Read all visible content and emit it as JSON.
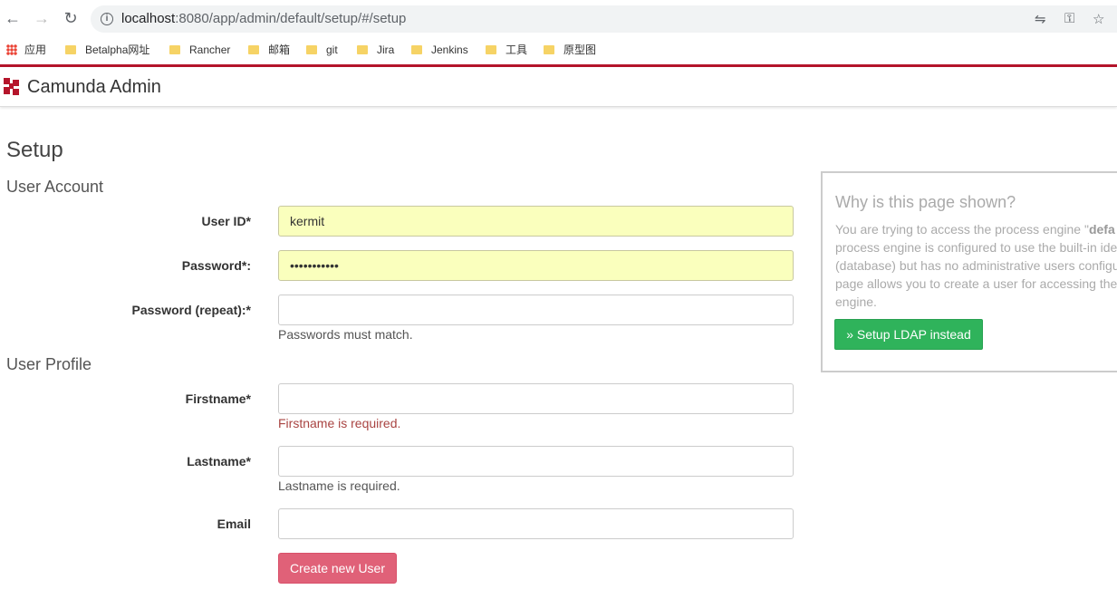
{
  "browser": {
    "url_host": "localhost",
    "url_rest": ":8080/app/admin/default/setup/#/setup",
    "bookmarks": [
      {
        "label": "应用",
        "icon": "apps-grid-icon"
      },
      {
        "label": "Betalpha网址",
        "icon": "folder-icon"
      },
      {
        "label": "Rancher",
        "icon": "folder-icon"
      },
      {
        "label": "邮箱",
        "icon": "folder-icon"
      },
      {
        "label": "git",
        "icon": "folder-icon"
      },
      {
        "label": "Jira",
        "icon": "folder-icon"
      },
      {
        "label": "Jenkins",
        "icon": "folder-icon"
      },
      {
        "label": "工具",
        "icon": "folder-icon"
      },
      {
        "label": "原型图",
        "icon": "folder-icon"
      }
    ]
  },
  "header": {
    "brand": "Camunda Admin",
    "accent": "#b5152b"
  },
  "page": {
    "title": "Setup",
    "user_account": {
      "heading": "User Account",
      "user_id_label": "User ID*",
      "user_id_value": "kermit",
      "password_label": "Password*:",
      "password_value": "•••••••••••",
      "password_repeat_label": "Password (repeat):*",
      "password_repeat_value": "",
      "password_help": "Passwords must match."
    },
    "user_profile": {
      "heading": "User Profile",
      "firstname_label": "Firstname*",
      "firstname_value": "",
      "firstname_error": "Firstname is required.",
      "lastname_label": "Lastname*",
      "lastname_value": "",
      "lastname_help": "Lastname is required.",
      "email_label": "Email",
      "email_value": ""
    },
    "create_button": "Create new User"
  },
  "panel": {
    "title": "Why is this page shown?",
    "text_pre": "You are trying to access the process engine \"",
    "text_bold": "defa",
    "line2": "process engine is configured to use the built-in ide",
    "line3": "(database) but has no administrative users configu",
    "line4": "page allows you to create a user for accessing the",
    "line5": "engine.",
    "ldap_button": "» Setup LDAP instead"
  }
}
